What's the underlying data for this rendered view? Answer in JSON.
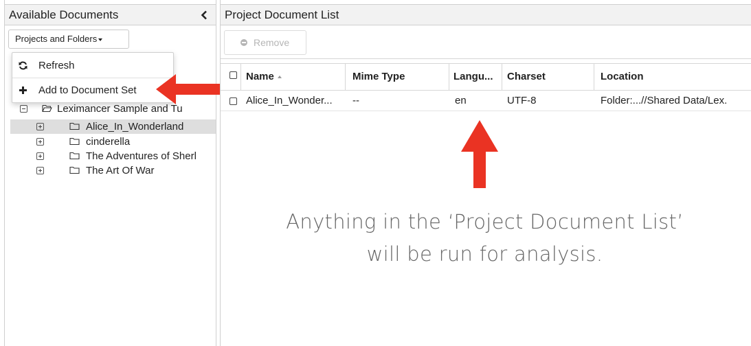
{
  "left_panel": {
    "title": "Available Documents",
    "dropdown_label": "Projects and Folders",
    "context_menu": [
      {
        "label": "Refresh",
        "icon": "refresh-icon"
      },
      {
        "label": "Add to Document Set",
        "icon": "plus-icon"
      }
    ],
    "tree": {
      "root": {
        "label": "Leximancer Sample and Tu",
        "icon": "folder-open-icon",
        "toggle": "collapse"
      },
      "children": [
        {
          "label": "Alice_In_Wonderland",
          "selected": true
        },
        {
          "label": "cinderella",
          "selected": false
        },
        {
          "label": "The Adventures of Sherl",
          "selected": false
        },
        {
          "label": "The Art Of War",
          "selected": false
        }
      ]
    }
  },
  "right_panel": {
    "title": "Project Document List",
    "remove_label": "Remove",
    "columns": [
      "Name",
      "Mime Type",
      "Langu...",
      "Charset",
      "Location"
    ],
    "sort_column": "Name",
    "rows": [
      {
        "name": "Alice_In_Wonder...",
        "mime_type": "--",
        "language": "en",
        "charset": "UTF-8",
        "location": "Folder:...//Shared Data/Lex."
      }
    ]
  },
  "annotation": {
    "line1": "Anything in the ‘Project Document List’",
    "line2": "will be run for analysis."
  },
  "colors": {
    "arrow": "#ea3323",
    "header_bg": "#f2f2f2",
    "selected_row": "#dedede",
    "annotation_text": "#666666"
  }
}
